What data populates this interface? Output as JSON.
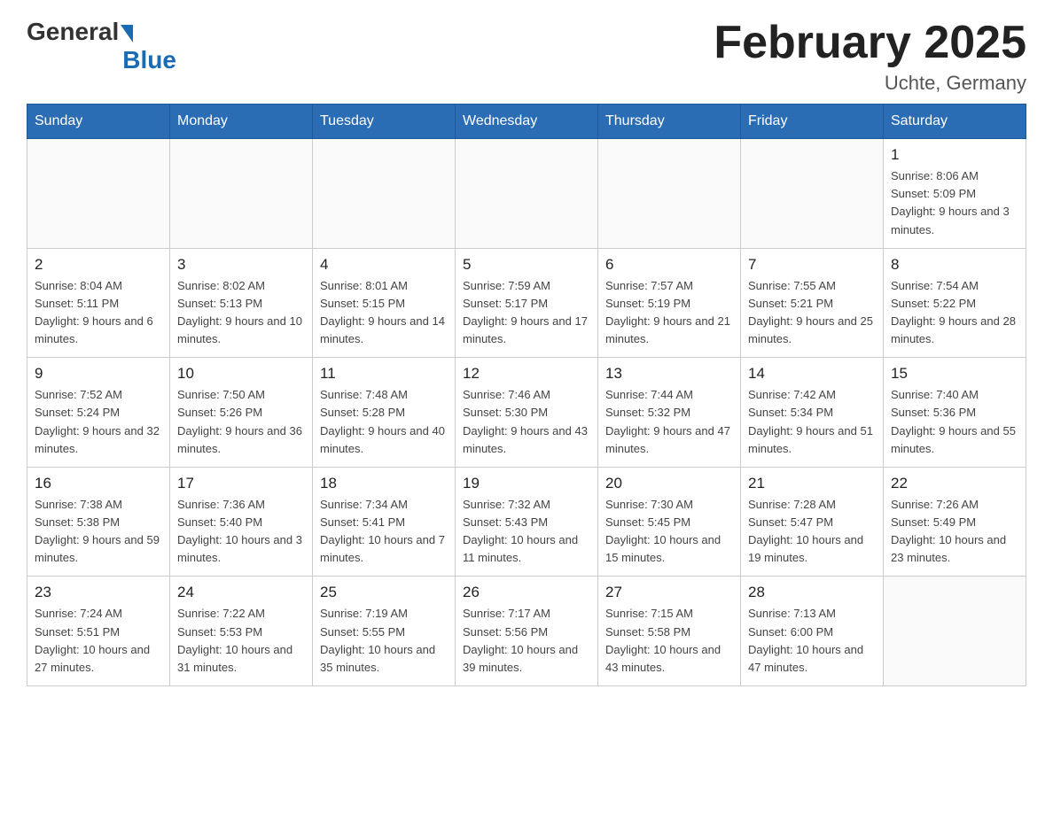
{
  "header": {
    "logo_general": "General",
    "logo_blue": "Blue",
    "month_title": "February 2025",
    "location": "Uchte, Germany"
  },
  "weekdays": [
    "Sunday",
    "Monday",
    "Tuesday",
    "Wednesday",
    "Thursday",
    "Friday",
    "Saturday"
  ],
  "weeks": [
    [
      {
        "day": "",
        "info": ""
      },
      {
        "day": "",
        "info": ""
      },
      {
        "day": "",
        "info": ""
      },
      {
        "day": "",
        "info": ""
      },
      {
        "day": "",
        "info": ""
      },
      {
        "day": "",
        "info": ""
      },
      {
        "day": "1",
        "info": "Sunrise: 8:06 AM\nSunset: 5:09 PM\nDaylight: 9 hours and 3 minutes."
      }
    ],
    [
      {
        "day": "2",
        "info": "Sunrise: 8:04 AM\nSunset: 5:11 PM\nDaylight: 9 hours and 6 minutes."
      },
      {
        "day": "3",
        "info": "Sunrise: 8:02 AM\nSunset: 5:13 PM\nDaylight: 9 hours and 10 minutes."
      },
      {
        "day": "4",
        "info": "Sunrise: 8:01 AM\nSunset: 5:15 PM\nDaylight: 9 hours and 14 minutes."
      },
      {
        "day": "5",
        "info": "Sunrise: 7:59 AM\nSunset: 5:17 PM\nDaylight: 9 hours and 17 minutes."
      },
      {
        "day": "6",
        "info": "Sunrise: 7:57 AM\nSunset: 5:19 PM\nDaylight: 9 hours and 21 minutes."
      },
      {
        "day": "7",
        "info": "Sunrise: 7:55 AM\nSunset: 5:21 PM\nDaylight: 9 hours and 25 minutes."
      },
      {
        "day": "8",
        "info": "Sunrise: 7:54 AM\nSunset: 5:22 PM\nDaylight: 9 hours and 28 minutes."
      }
    ],
    [
      {
        "day": "9",
        "info": "Sunrise: 7:52 AM\nSunset: 5:24 PM\nDaylight: 9 hours and 32 minutes."
      },
      {
        "day": "10",
        "info": "Sunrise: 7:50 AM\nSunset: 5:26 PM\nDaylight: 9 hours and 36 minutes."
      },
      {
        "day": "11",
        "info": "Sunrise: 7:48 AM\nSunset: 5:28 PM\nDaylight: 9 hours and 40 minutes."
      },
      {
        "day": "12",
        "info": "Sunrise: 7:46 AM\nSunset: 5:30 PM\nDaylight: 9 hours and 43 minutes."
      },
      {
        "day": "13",
        "info": "Sunrise: 7:44 AM\nSunset: 5:32 PM\nDaylight: 9 hours and 47 minutes."
      },
      {
        "day": "14",
        "info": "Sunrise: 7:42 AM\nSunset: 5:34 PM\nDaylight: 9 hours and 51 minutes."
      },
      {
        "day": "15",
        "info": "Sunrise: 7:40 AM\nSunset: 5:36 PM\nDaylight: 9 hours and 55 minutes."
      }
    ],
    [
      {
        "day": "16",
        "info": "Sunrise: 7:38 AM\nSunset: 5:38 PM\nDaylight: 9 hours and 59 minutes."
      },
      {
        "day": "17",
        "info": "Sunrise: 7:36 AM\nSunset: 5:40 PM\nDaylight: 10 hours and 3 minutes."
      },
      {
        "day": "18",
        "info": "Sunrise: 7:34 AM\nSunset: 5:41 PM\nDaylight: 10 hours and 7 minutes."
      },
      {
        "day": "19",
        "info": "Sunrise: 7:32 AM\nSunset: 5:43 PM\nDaylight: 10 hours and 11 minutes."
      },
      {
        "day": "20",
        "info": "Sunrise: 7:30 AM\nSunset: 5:45 PM\nDaylight: 10 hours and 15 minutes."
      },
      {
        "day": "21",
        "info": "Sunrise: 7:28 AM\nSunset: 5:47 PM\nDaylight: 10 hours and 19 minutes."
      },
      {
        "day": "22",
        "info": "Sunrise: 7:26 AM\nSunset: 5:49 PM\nDaylight: 10 hours and 23 minutes."
      }
    ],
    [
      {
        "day": "23",
        "info": "Sunrise: 7:24 AM\nSunset: 5:51 PM\nDaylight: 10 hours and 27 minutes."
      },
      {
        "day": "24",
        "info": "Sunrise: 7:22 AM\nSunset: 5:53 PM\nDaylight: 10 hours and 31 minutes."
      },
      {
        "day": "25",
        "info": "Sunrise: 7:19 AM\nSunset: 5:55 PM\nDaylight: 10 hours and 35 minutes."
      },
      {
        "day": "26",
        "info": "Sunrise: 7:17 AM\nSunset: 5:56 PM\nDaylight: 10 hours and 39 minutes."
      },
      {
        "day": "27",
        "info": "Sunrise: 7:15 AM\nSunset: 5:58 PM\nDaylight: 10 hours and 43 minutes."
      },
      {
        "day": "28",
        "info": "Sunrise: 7:13 AM\nSunset: 6:00 PM\nDaylight: 10 hours and 47 minutes."
      },
      {
        "day": "",
        "info": ""
      }
    ]
  ]
}
